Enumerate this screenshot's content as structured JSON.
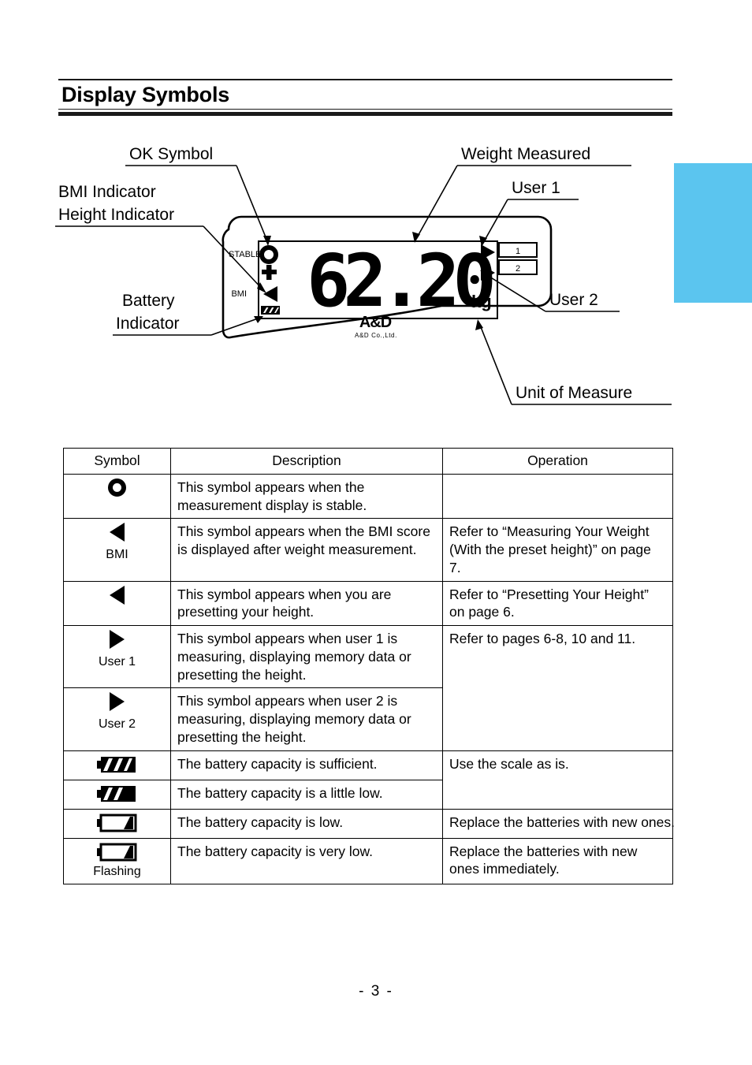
{
  "page_title": "Display Symbols",
  "page_number": "-  3  -",
  "accent_color": "#5BC5EF",
  "diagram": {
    "callouts": {
      "ok_symbol": "OK Symbol",
      "bmi_indicator": "BMI Indicator",
      "height_indicator": "Height Indicator",
      "battery_indicator_line1": "Battery",
      "battery_indicator_line2": "Indicator",
      "weight_measured": "Weight Measured",
      "user1": "User 1",
      "user2": "User 2",
      "unit_of_measure": "Unit of Measure"
    },
    "lcd": {
      "stable_label": "STABLE",
      "bmi_label": "BMI",
      "value": "62.20",
      "unit": "kg",
      "user1_box": "1",
      "user2_box": "2",
      "brand": "A&D",
      "brand_sub": "A&D Co.,Ltd."
    }
  },
  "table": {
    "headers": [
      "Symbol",
      "Description",
      "Operation"
    ],
    "rows": [
      {
        "symbol_icon": "circle-stable-icon",
        "symbol_sub": "",
        "description": "This symbol appears when the measurement display is stable.",
        "operation": "",
        "operation_rowspan": 1,
        "operation_small": false
      },
      {
        "symbol_icon": "triangle-left-icon",
        "symbol_sub": "BMI",
        "description": "This symbol appears when the BMI score is displayed after weight measurement.",
        "operation": "Refer to “Measuring Your Weight (With the preset height)” on page 7.",
        "operation_rowspan": 1,
        "operation_small": false
      },
      {
        "symbol_icon": "triangle-left-icon",
        "symbol_sub": "",
        "description": "This symbol appears when you are presetting your height.",
        "operation": "Refer to “Presetting Your Height” on page 6.",
        "operation_rowspan": 1,
        "operation_small": false
      },
      {
        "symbol_icon": "triangle-right-icon",
        "symbol_sub": "User 1",
        "description": "This symbol appears when user 1 is measuring, displaying memory data or presetting the height.",
        "operation": "Refer to pages 6-8, 10 and 11.",
        "operation_rowspan": 2,
        "operation_small": false
      },
      {
        "symbol_icon": "triangle-right-icon",
        "symbol_sub": "User 2",
        "description": "This symbol appears when user 2 is measuring, displaying memory data or presetting the height.",
        "operation": null,
        "operation_rowspan": 0,
        "operation_small": false
      },
      {
        "symbol_icon": "battery-full-icon",
        "symbol_sub": "",
        "description": "The battery capacity is sufficient.",
        "operation": "Use the scale as is.",
        "operation_rowspan": 2,
        "operation_small": false
      },
      {
        "symbol_icon": "battery-two-thirds-icon",
        "symbol_sub": "",
        "description": "The battery capacity is a little low.",
        "operation": null,
        "operation_rowspan": 0,
        "operation_small": false
      },
      {
        "symbol_icon": "battery-low-icon",
        "symbol_sub": "",
        "description": "The battery capacity is low.",
        "operation": "Replace the batteries with new ones.",
        "operation_rowspan": 1,
        "operation_small": true
      },
      {
        "symbol_icon": "battery-very-low-icon",
        "symbol_sub": "Flashing",
        "description": "The battery capacity is very low.",
        "operation": "Replace the batteries with new ones immediately.",
        "operation_rowspan": 1,
        "operation_small": false
      }
    ]
  }
}
